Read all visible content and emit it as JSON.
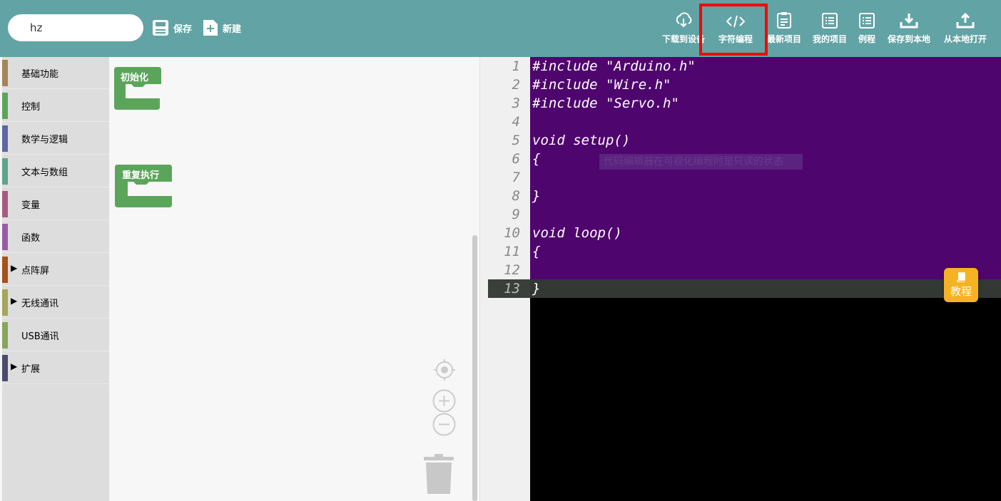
{
  "toolbar": {
    "project_name": "hz",
    "save_label": "保存",
    "new_label": "新建",
    "right_buttons": [
      {
        "label": "下载到设备",
        "icon": "cloud-download-icon"
      },
      {
        "label": "字符编程",
        "icon": "code-icon"
      },
      {
        "label": "最新项目",
        "icon": "clipboard-icon"
      },
      {
        "label": "我的项目",
        "icon": "folder-list-icon"
      },
      {
        "label": "例程",
        "icon": "example-list-icon"
      },
      {
        "label": "保存到本地",
        "icon": "download-tray-icon"
      },
      {
        "label": "从本地打开",
        "icon": "upload-tray-icon"
      }
    ]
  },
  "sidebar": {
    "categories": [
      {
        "label": "基础功能",
        "color": "#a5845b",
        "expandable": false
      },
      {
        "label": "控制",
        "color": "#5ba55b",
        "expandable": false
      },
      {
        "label": "数学与逻辑",
        "color": "#5b67a5",
        "expandable": false
      },
      {
        "label": "文本与数组",
        "color": "#5ba58c",
        "expandable": false
      },
      {
        "label": "变量",
        "color": "#a55b80",
        "expandable": false
      },
      {
        "label": "函数",
        "color": "#995ba5",
        "expandable": false
      },
      {
        "label": "点阵屏",
        "color": "#a5521b",
        "expandable": true
      },
      {
        "label": "无线通讯",
        "color": "#a5a55b",
        "expandable": true
      },
      {
        "label": "USB通讯",
        "color": "#88a55b",
        "expandable": false
      },
      {
        "label": "扩展",
        "color": "#4b4b6e",
        "expandable": true
      }
    ]
  },
  "workspace": {
    "blocks": [
      {
        "label": "初始化"
      },
      {
        "label": "重复执行"
      }
    ]
  },
  "editor": {
    "line_numbers": [
      "1",
      "2",
      "3",
      "4",
      "5",
      "6",
      "7",
      "8",
      "9",
      "10",
      "11",
      "12",
      "13"
    ],
    "lines": [
      "#include \"Arduino.h\"",
      "#include \"Wire.h\"",
      "#include \"Servo.h\"",
      "",
      "void setup()",
      "{",
      "",
      "}",
      "",
      "void loop()",
      "{",
      "",
      "}"
    ],
    "overlay_note": "代码编辑器在可视化编程时是只读的状态",
    "tutorial_label": "教程"
  },
  "colors": {
    "topbar": "#62a3a5",
    "highlight": "#ff0000",
    "code_bg": "#4f056e",
    "block": "#5ba55b",
    "tutorial": "#f5b323"
  }
}
